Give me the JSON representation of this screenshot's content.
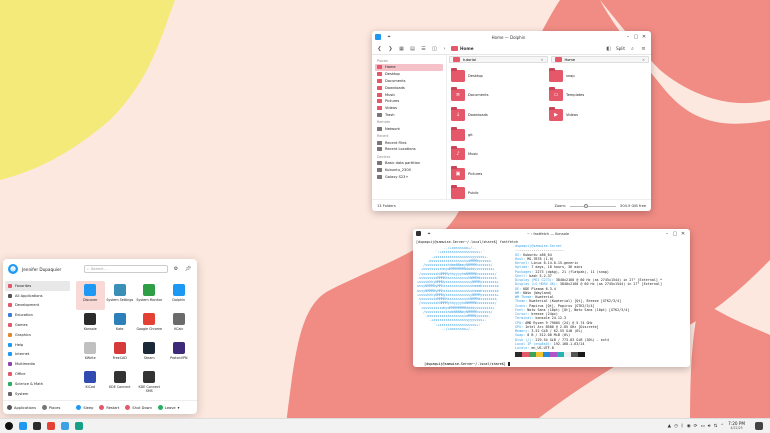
{
  "dolphin": {
    "title": "Home — Dolphin",
    "toolbar": {
      "crumb": "Home",
      "split_label": "Split"
    },
    "places_header": "Places",
    "places": [
      "Home",
      "Desktop",
      "Documents",
      "Downloads",
      "Music",
      "Pictures",
      "Videos",
      "Trash"
    ],
    "remote_header": "Remote",
    "remote": [
      "Network"
    ],
    "recent_header": "Recent",
    "recent": [
      "Recent Files",
      "Recent Locations"
    ],
    "devices_header": "Devices",
    "devices": [
      "Basic data partition",
      "Kubuntu_2300",
      "Galaxy S23+"
    ],
    "tabs": [
      {
        "label": "tutorial"
      },
      {
        "label": "Home"
      }
    ],
    "items": [
      "Desktop",
      "snap",
      "Documents",
      "Templates",
      "Downloads",
      "Videos",
      "git",
      "Music",
      "Pictures",
      "Public"
    ],
    "status_left": "13 Folders",
    "zoom_label": "Zoom:",
    "status_right": "504.9 GiB free"
  },
  "konsole": {
    "title": "~ : fastfetch — Konsole",
    "prompt1": "[dupaquij@samwise-Server~/.local/share$] fastfetch",
    "art": [
      "             .-/+oossssoo+/-.",
      "         `:+ssssssssssssssssss+:`",
      "       -+ssssssssssssssssssyyssss+-",
      "     .ossssssssssssssssssdMMMNysssso.",
      "   /ssssssssssshdmmNNmmyNMMMMhssssss/",
      "  +ssssssssshmydMMMMMMMNddddyssssssss+",
      " /sssssssshNMMMyhhyyyyhmNMMMNhssssssss/",
      ".ssssssssdMMMNhsssssssssshNMMMdssssssss.",
      "+sssshhhyNMMNyssssssssssssyNMMMysssssss+",
      "ossyNMMMNyMMhsssssssssssssshmmmhssssssso",
      "ossyNMMMNyMMhsssssssssssssshmmmhssssssso",
      "+sssshhhyNMMNyssssssssssssyNMMMysssssss+",
      ".ssssssssdMMMNhsssssssssshNMMMdssssssss.",
      " /sssssssshNMMMyhhyyyyhdNMMMNhssssssss/",
      "  +sssssssssdmydMMMMMMMMddddyssssssss+",
      "   /ssssssssssshdmNNNNmyNMMMMhssssss/",
      "    .ossssssssssssssssssdMMMNysssso.",
      "      -+sssssssssssssssssyyyssss+-",
      "        `:+ssssssssssssssssss+:`",
      "            .-/+oossssoo+/-."
    ],
    "host": "dupaquij@samwise-Server",
    "separator": "------------------------",
    "info": [
      {
        "key": "OS:",
        "val": " Kubuntu x86_64"
      },
      {
        "key": "Host:",
        "val": " MS-7B78 (1.0)"
      },
      {
        "key": "Kernel:",
        "val": " Linux 6.14.0-15-generic"
      },
      {
        "key": "Uptime:",
        "val": " 7 days, 18 hours, 36 mins"
      },
      {
        "key": "Packages:",
        "val": " 2273 (dpkg), 21 (flatpak), 11 (snap)"
      },
      {
        "key": "Shell:",
        "val": " bash 5.2.37"
      },
      {
        "key": "Display (MSI G273):",
        "val": " 3840x2160 @ 60 Hz (as 2745x1544) in 27\" [External] *"
      },
      {
        "key": "Display (LG HDR4 4K):",
        "val": " 3840x2160 @ 60 Hz (as 2745x1544) in 27\" [External]"
      },
      {
        "key": "DE:",
        "val": " KDE Plasma 6.3.4"
      },
      {
        "key": "WM:",
        "val": " KWin (Wayland)"
      },
      {
        "key": "WM Theme:",
        "val": " Kwaterial"
      },
      {
        "key": "Theme:",
        "val": " Kwaterial (Kwaterial) [Qt], Breeze [GTK2/3/4]"
      },
      {
        "key": "Icons:",
        "val": " Papirus [Qt], Papirus [GTK2/3/4]"
      },
      {
        "key": "Font:",
        "val": " Noto Sans (10pt) [Qt], Noto Sans (10pt) [GTK2/3/4]"
      },
      {
        "key": "Cursor:",
        "val": " breeze (24px)"
      },
      {
        "key": "Terminal:",
        "val": " konsole 24.12.3"
      },
      {
        "key": "CPU:",
        "val": " AMD Ryzen 9 7900X (24) @ 5.74 GHz"
      },
      {
        "key": "GPU:",
        "val": " Intel Arc B580 @ 2.85 GHz [Discrete]"
      },
      {
        "key": "Memory:",
        "val": " 3.52 GiB / 62.55 GiB (6%)"
      },
      {
        "key": "Swap:",
        "val": " 0 B / 512.00 MiB (0%)"
      },
      {
        "key": "Disk (/):",
        "val": " 229.54 GiB / 773.83 GiB (30%) - ext4"
      },
      {
        "key": "Local IP (enp8s0):",
        "val": " 192.168.1.63/24"
      },
      {
        "key": "Locale:",
        "val": " en_US.UTF-8"
      }
    ],
    "swatches": [
      "#2b2b2b",
      "#e45869",
      "#3ea35a",
      "#f2c230",
      "#2a8bd8",
      "#b054c6",
      "#27b3b3",
      "#f0f0f0",
      "#555555",
      "#1a1a1a"
    ],
    "prompt2": "[dupaquij@samwise-Server~/.local/share$] "
  },
  "launcher": {
    "user": "Jennifer Dupaquier",
    "search_placeholder": "Search...",
    "categories": [
      "Favorites",
      "All Applications",
      "Development",
      "Education",
      "Games",
      "Graphics",
      "Help",
      "Internet",
      "Multimedia",
      "Office",
      "Science & Math",
      "System"
    ],
    "category_colors": [
      "#e45869",
      "#555555",
      "#e45869",
      "#3a7bd5",
      "#e45869",
      "#e08a2c",
      "#1d99f3",
      "#1d99f3",
      "#8e44ad",
      "#e45869",
      "#27ae60",
      "#666666"
    ],
    "apps": [
      {
        "label": "Discover",
        "color": "#1d99f3"
      },
      {
        "label": "System Settings",
        "color": "#3a8fb7"
      },
      {
        "label": "System Monitor",
        "color": "#2e9e47"
      },
      {
        "label": "Dolphin",
        "color": "#1d99f3"
      },
      {
        "label": "Konsole",
        "color": "#2b2b2b"
      },
      {
        "label": "Kate",
        "color": "#2c7fb8"
      },
      {
        "label": "Google Chrome",
        "color": "#e34133"
      },
      {
        "label": "KCalc",
        "color": "#6b6b6b"
      },
      {
        "label": "KWrite",
        "color": "#c0c0c0"
      },
      {
        "label": "FreeCAD",
        "color": "#d63a3a"
      },
      {
        "label": "Steam",
        "color": "#1b2838"
      },
      {
        "label": "ProtonVPN",
        "color": "#3d2b7a"
      },
      {
        "label": "KiCad",
        "color": "#314cb0"
      },
      {
        "label": "KDE Connect",
        "color": "#333333"
      },
      {
        "label": "KDE Connect SMS",
        "color": "#333333"
      }
    ],
    "footer": {
      "applications": "Applications",
      "places": "Places",
      "sleep": "Sleep",
      "restart": "Restart",
      "shutdown": "Shut Down",
      "leave": "Leave"
    }
  },
  "taskbar": {
    "pinned": [
      {
        "name": "app-launcher",
        "color": "#111111"
      },
      {
        "name": "dolphin",
        "color": "#1d99f3"
      },
      {
        "name": "konsole",
        "color": "#2b2b2b"
      },
      {
        "name": "chrome",
        "color": "#e34133"
      },
      {
        "name": "discover",
        "color": "#3da2e3"
      },
      {
        "name": "kde-connect",
        "color": "#16a085"
      }
    ],
    "time": "7:20 PM",
    "date": "4/22/25"
  },
  "colors": {
    "accent": "#e45869",
    "wallpaper_pink": "#f08c84",
    "wallpaper_yellow": "#f4ea79",
    "wallpaper_cream": "#fde8df"
  }
}
